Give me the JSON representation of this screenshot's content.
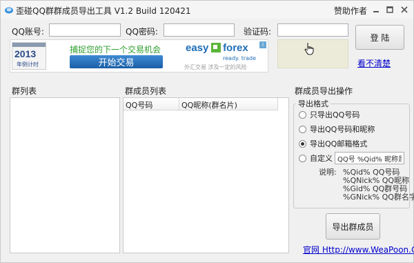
{
  "window": {
    "title": "歪碰QQ群群成员导出工具  V1.2 Build 120421",
    "sponsor_link": "赞助作者"
  },
  "login": {
    "qq_account_label": "QQ账号:",
    "qq_account_value": "",
    "qq_password_label": "QQ密码:",
    "qq_password_value": "",
    "captcha_label": "验证码:",
    "captcha_value": "",
    "login_button": "登  陆",
    "refresh_captcha_link": "看不清楚"
  },
  "ad_banner": {
    "badge_year": "2013",
    "badge_sub": "年倒计时",
    "headline": "捕捉您的下一个交易机会",
    "cta": "开始交易",
    "brand_left": "easy",
    "brand_right": "forex",
    "brand_tagline": "ready. trade",
    "disclaimer": "外汇交易 涉及一定的风险",
    "info_mark": "i"
  },
  "groups": {
    "label": "群列表",
    "items": []
  },
  "members": {
    "label": "群成员列表",
    "columns": [
      "QQ号码",
      "QQ昵称(群名片)"
    ],
    "rows": []
  },
  "export": {
    "section_label": "群成员导出操作",
    "group_title": "导出格式",
    "options": [
      {
        "label": "只导出QQ号码",
        "selected": false
      },
      {
        "label": "导出QQ号码和昵称",
        "selected": false
      },
      {
        "label": "导出QQ邮箱格式",
        "selected": true
      },
      {
        "label": "自定义",
        "selected": false
      }
    ],
    "custom_format_value": "QQ号 %Qid% 昵称是 %",
    "help_label": "说明:",
    "help_lines": [
      "%Qid%  QQ号码",
      "%QNick%  QQ昵称",
      "%Gid%  QQ群号码",
      "%GNick%  QQ群名字"
    ],
    "export_button": "导出群成员",
    "website_link": "官网 Http://www.WeaPoon.Com"
  },
  "colors": {
    "window_bg": "#f0f0f0",
    "link": "#0000cc",
    "banner_green": "#2e9e2e",
    "banner_blue": "#1e6db8",
    "captcha_bg": "#ecebd9"
  }
}
